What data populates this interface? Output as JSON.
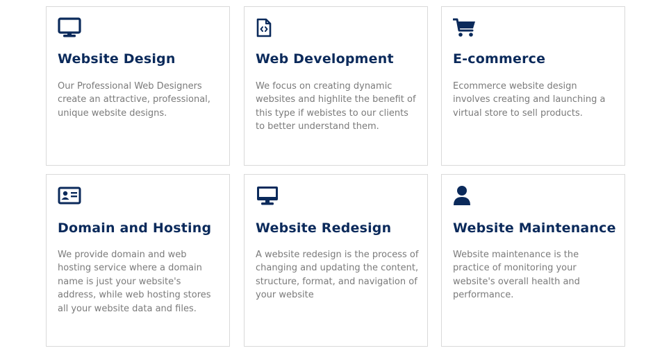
{
  "colors": {
    "accent": "#0b2a5b",
    "text_muted": "#7a7a7a",
    "border": "#d9d9d9"
  },
  "services": [
    {
      "icon": "desktop-monitor-icon",
      "title": "Website Design",
      "description": "Our Professional Web Designers create an attractive, professional, unique website designs."
    },
    {
      "icon": "code-file-icon",
      "title": "Web Development",
      "description": "We focus on creating dynamic websites and highlite the benefit of this type if webistes to our clients to better understand them."
    },
    {
      "icon": "shopping-cart-icon",
      "title": "E-commerce",
      "description": "Ecommerce website design involves creating and launching a virtual store to sell products."
    },
    {
      "icon": "id-card-icon",
      "title": "Domain and Hosting",
      "description": "We provide domain and web hosting service where a domain name is just your website's address, while web hosting stores all your website data and files."
    },
    {
      "icon": "desktop-monitor-icon",
      "title": "Website Redesign",
      "description": "A website redesign is the process of changing and updating the content, structure, format, and navigation of your website"
    },
    {
      "icon": "user-icon",
      "title": "Website Maintenance",
      "description": "Website maintenance is the practice of monitoring your website's overall health and performance."
    }
  ]
}
